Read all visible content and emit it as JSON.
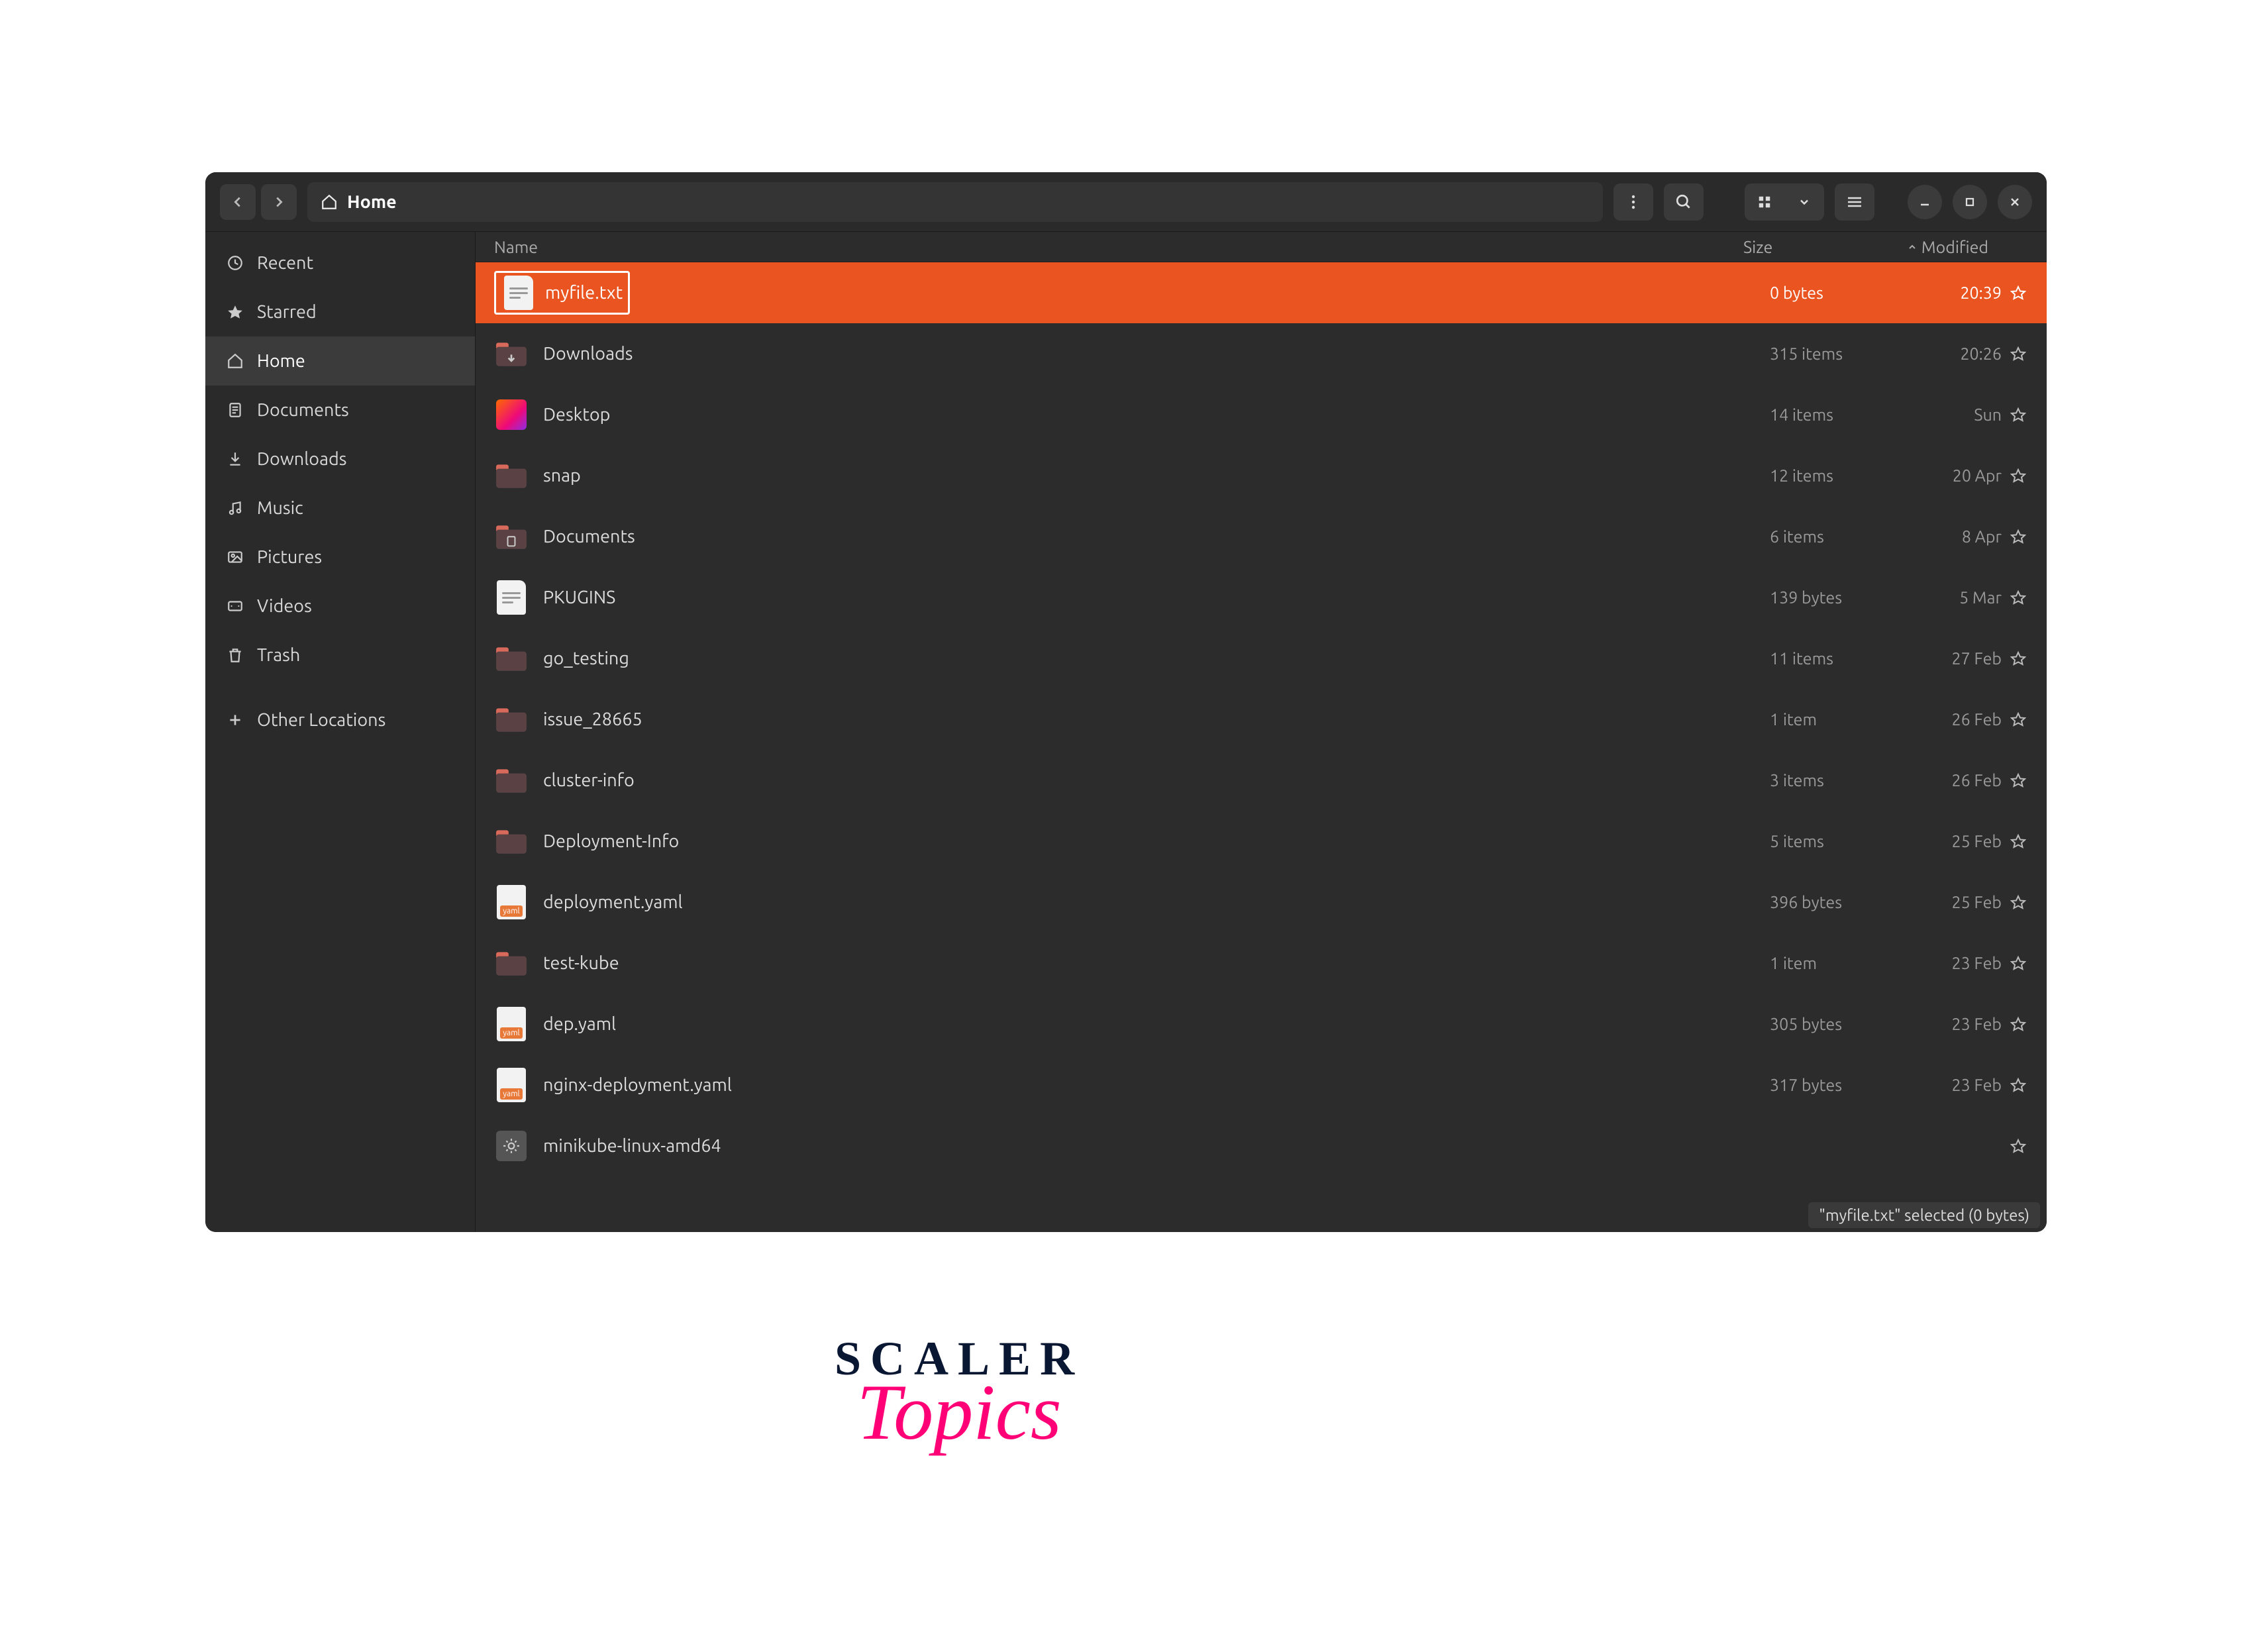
{
  "titlebar": {
    "path_label": "Home"
  },
  "columns": {
    "name": "Name",
    "size": "Size",
    "modified": "Modified"
  },
  "sidebar": {
    "items": [
      {
        "icon": "recent-icon",
        "label": "Recent"
      },
      {
        "icon": "star-icon",
        "label": "Starred"
      },
      {
        "icon": "home-icon",
        "label": "Home",
        "active": true
      },
      {
        "icon": "document-icon",
        "label": "Documents"
      },
      {
        "icon": "download-icon",
        "label": "Downloads"
      },
      {
        "icon": "music-icon",
        "label": "Music"
      },
      {
        "icon": "picture-icon",
        "label": "Pictures"
      },
      {
        "icon": "video-icon",
        "label": "Videos"
      },
      {
        "icon": "trash-icon",
        "label": "Trash"
      },
      {
        "icon": "plus-icon",
        "label": "Other Locations"
      }
    ]
  },
  "files": [
    {
      "type": "text",
      "name": "myfile.txt",
      "size": "0 bytes",
      "modified": "20:39",
      "selected": true
    },
    {
      "type": "folder-dl",
      "name": "Downloads",
      "size": "315 items",
      "modified": "20:26"
    },
    {
      "type": "desktop",
      "name": "Desktop",
      "size": "14 items",
      "modified": "Sun"
    },
    {
      "type": "folder",
      "name": "snap",
      "size": "12 items",
      "modified": "20 Apr"
    },
    {
      "type": "folder-doc",
      "name": "Documents",
      "size": "6 items",
      "modified": "8 Apr"
    },
    {
      "type": "text",
      "name": "PKUGINS",
      "size": "139 bytes",
      "modified": "5 Mar"
    },
    {
      "type": "folder",
      "name": "go_testing",
      "size": "11 items",
      "modified": "27 Feb"
    },
    {
      "type": "folder",
      "name": "issue_28665",
      "size": "1 item",
      "modified": "26 Feb"
    },
    {
      "type": "folder",
      "name": "cluster-info",
      "size": "3 items",
      "modified": "26 Feb"
    },
    {
      "type": "folder",
      "name": "Deployment-Info",
      "size": "5 items",
      "modified": "25 Feb"
    },
    {
      "type": "yaml",
      "name": "deployment.yaml",
      "size": "396 bytes",
      "modified": "25 Feb"
    },
    {
      "type": "folder",
      "name": "test-kube",
      "size": "1 item",
      "modified": "23 Feb"
    },
    {
      "type": "yaml",
      "name": "dep.yaml",
      "size": "305 bytes",
      "modified": "23 Feb"
    },
    {
      "type": "yaml",
      "name": "nginx-deployment.yaml",
      "size": "317 bytes",
      "modified": "23 Feb"
    },
    {
      "type": "bin",
      "name": "minikube-linux-amd64",
      "size": "",
      "modified": ""
    }
  ],
  "status": "\"myfile.txt\" selected  (0 bytes)",
  "brand": {
    "line1": "SCALER",
    "line2": "Topics"
  }
}
